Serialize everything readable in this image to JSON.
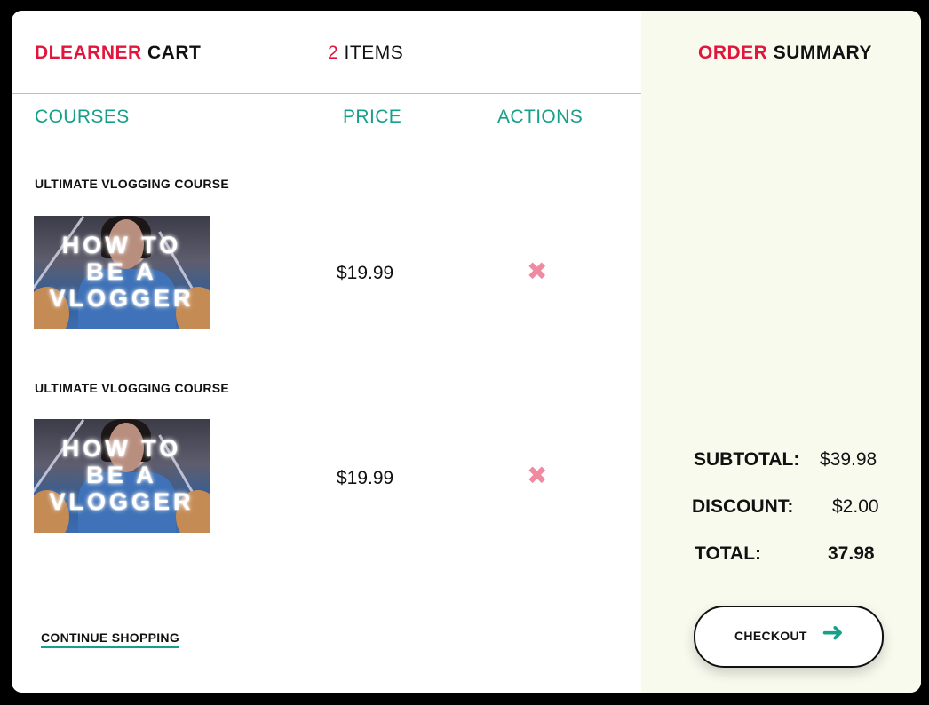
{
  "header": {
    "brand_accent": "DLEARNER",
    "brand_rest": "CART",
    "item_count": "2",
    "items_label": "ITEMS",
    "summary_accent": "ORDER",
    "summary_rest": "SUMMARY"
  },
  "columns": {
    "courses": "COURSES",
    "price": "PRICE",
    "actions": "ACTIONS"
  },
  "cart_items": [
    {
      "title": "ULTIMATE VLOGGING COURSE",
      "thumb_line1": "HOW TO",
      "thumb_line2": "BE A",
      "thumb_line3": "VLOGGER",
      "price": "$19.99",
      "remove_icon": "✖"
    },
    {
      "title": "ULTIMATE VLOGGING COURSE",
      "thumb_line1": "HOW TO",
      "thumb_line2": "BE A",
      "thumb_line3": "VLOGGER",
      "price": "$19.99",
      "remove_icon": "✖"
    }
  ],
  "continue_shopping": "CONTINUE SHOPPING",
  "summary": {
    "subtotal_label": "SUBTOTAL:",
    "subtotal_value": "$39.98",
    "discount_label": "DISCOUNT:",
    "discount_value": "$2.00",
    "total_label": "TOTAL:",
    "total_value": "37.98"
  },
  "checkout": {
    "label": "CHECKOUT",
    "arrow": "➜"
  },
  "colors": {
    "accent_red": "#e0163c",
    "accent_teal": "#16a08a",
    "summary_bg": "#f8faee",
    "remove_pink": "#f08aa0"
  }
}
